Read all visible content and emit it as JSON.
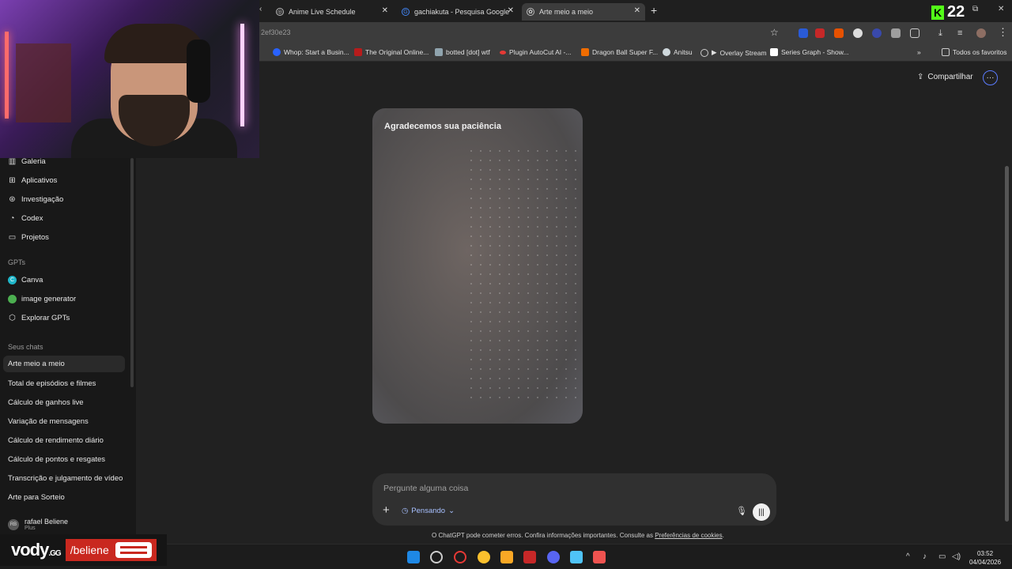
{
  "tabs": [
    {
      "label": "Anime Live Schedule"
    },
    {
      "label": "gachiakuta - Pesquisa Google"
    },
    {
      "label": "Arte meio a meio"
    }
  ],
  "kick_count": "22",
  "address": {
    "url": "2ef30e23"
  },
  "bookmarks": [
    "Whop: Start a Busin...",
    "The Original Online...",
    "botted [dot] wtf",
    "Plugin AutoCut AI -...",
    "Dragon Ball Super F...",
    "Anitsu",
    "Overlay Stream",
    "Series Graph - Show...",
    "Todos os favoritos"
  ],
  "sidebar": {
    "items": [
      {
        "label": "Galeria",
        "icon": "gallery-icon"
      },
      {
        "label": "Aplicativos",
        "icon": "apps-icon"
      },
      {
        "label": "Investigação",
        "icon": "research-icon"
      },
      {
        "label": "Codex",
        "icon": "codex-icon"
      },
      {
        "label": "Projetos",
        "icon": "folder-icon"
      }
    ],
    "gpts_heading": "GPTs",
    "gpts": [
      {
        "label": "Canva",
        "icon": "canva-icon"
      },
      {
        "label": "image generator",
        "icon": "image-generator-icon"
      },
      {
        "label": "Explorar GPTs",
        "icon": "explore-icon"
      }
    ],
    "chats_heading": "Seus chats",
    "chats": [
      "Arte meio a meio",
      "Total de episódios e filmes",
      "Cálculo de ganhos live",
      "Variação de mensagens",
      "Cálculo de rendimento diário",
      "Cálculo de pontos e resgates",
      "Transcrição e julgamento de vídeo",
      "Arte para Sorteio"
    ],
    "user": {
      "initials": "RB",
      "name": "rafael Beliene",
      "plan": "Plus"
    }
  },
  "header": {
    "share_label": "Compartilhar"
  },
  "image_card": {
    "title": "Agradecemos sua paciência"
  },
  "composer": {
    "placeholder": "Pergunte alguma coisa",
    "mode_label": "Pensando"
  },
  "disclaimer": {
    "text": "O ChatGPT pode cometer erros. Confira informações importantes. Consulte as ",
    "link": "Preferências de cookies",
    "end": "."
  },
  "overlay": {
    "brand": "vody",
    "domain": ".GG",
    "handle": "/beliene"
  },
  "clock": {
    "time": "03:52",
    "date": "04/04/2026"
  },
  "colors": {
    "accent": "#5b7cff",
    "kick": "#53fc18",
    "vody_red": "#c9281f"
  }
}
